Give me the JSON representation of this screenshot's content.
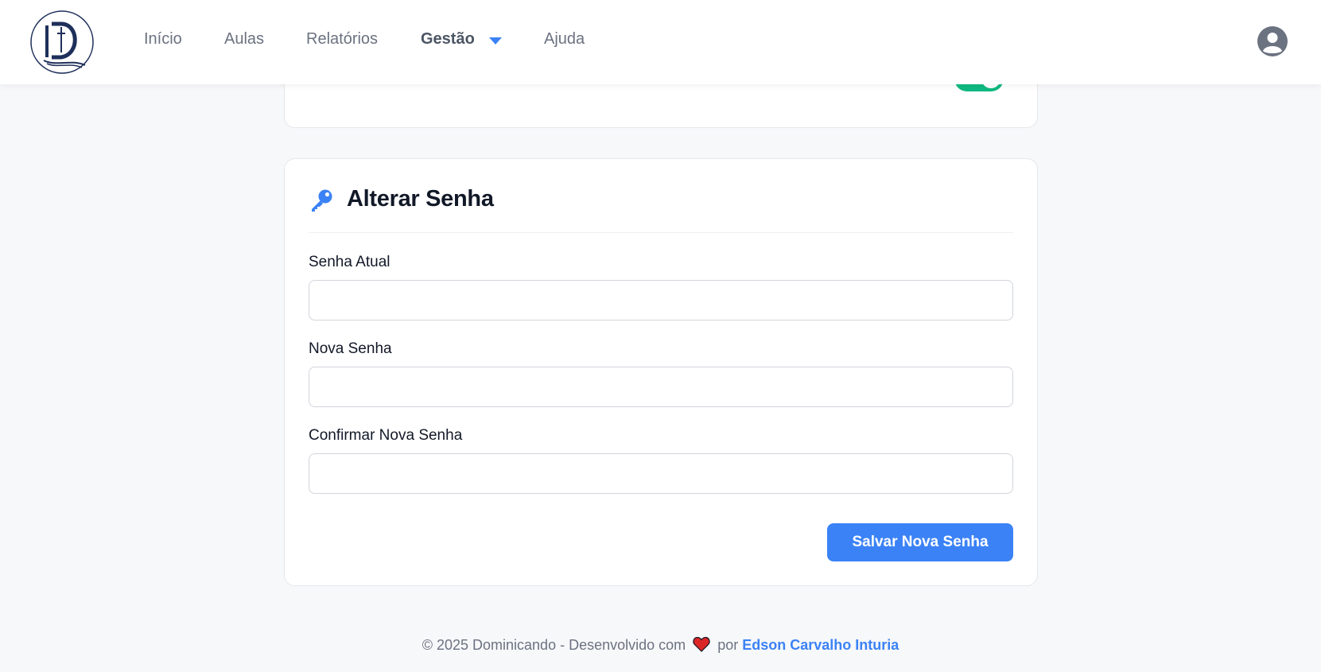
{
  "header": {
    "nav": [
      {
        "label": "Início"
      },
      {
        "label": "Aulas"
      },
      {
        "label": "Relatórios"
      },
      {
        "label": "Gestão"
      },
      {
        "label": "Ajuda"
      }
    ],
    "active_nav": "Gestão",
    "icons": {
      "logo": "dominicando-logo",
      "dropdown": "caret-down-icon",
      "user": "user-circle-icon"
    }
  },
  "top_card": {
    "toggle_on": true,
    "toggle_color": "#10b981"
  },
  "password_card": {
    "title": "Alterar Senha",
    "icon": "key-icon",
    "fields": [
      {
        "label": "Senha Atual",
        "value": "",
        "placeholder": ""
      },
      {
        "label": "Nova Senha",
        "value": "",
        "placeholder": ""
      },
      {
        "label": "Confirmar Nova Senha",
        "value": "",
        "placeholder": ""
      }
    ],
    "submit_label": "Salvar Nova Senha"
  },
  "footer": {
    "text_before": "© 2025 Dominicando - Desenvolvido com",
    "text_mid": "por",
    "author": "Edson Carvalho Inturia"
  },
  "colors": {
    "accent": "#3b82f6",
    "toggle": "#10b981",
    "background": "#f7f8fa",
    "heart": "#dc2626"
  }
}
